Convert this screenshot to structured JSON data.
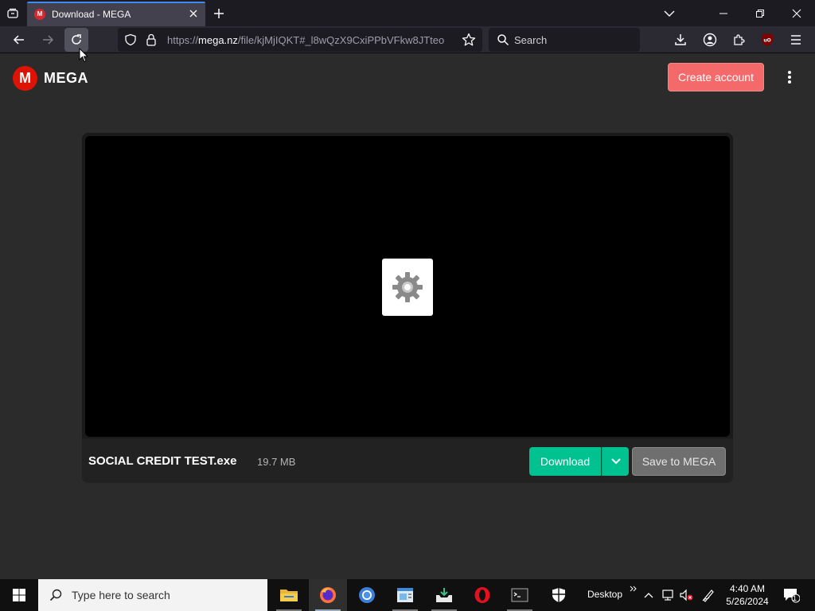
{
  "browser": {
    "tab": {
      "title": "Download - MEGA",
      "favicon": "mega-favicon"
    },
    "url": {
      "scheme": "https://",
      "host": "mega.nz",
      "path": "/file/kjMjIQKT#_l8wQzX9CxiPPbVFkw8JTteo"
    },
    "search_placeholder": "Search",
    "colors": {
      "tab_accent": "#3d8af7"
    }
  },
  "page": {
    "logo_letter": "M",
    "logo_text": "MEGA",
    "create_account_label": "Create account",
    "file": {
      "name": "SOCIAL CREDIT TEST.exe",
      "size": "19.7 MB"
    },
    "download_label": "Download",
    "save_label": "Save to MEGA",
    "colors": {
      "brand": "#dd1405",
      "download": "#00c290",
      "create_account": "#f46a6a"
    }
  },
  "taskbar": {
    "search_placeholder": "Type here to search",
    "desktop_label": "Desktop",
    "time": "4:40 AM",
    "date": "5/26/2024",
    "notification_count": "1"
  }
}
